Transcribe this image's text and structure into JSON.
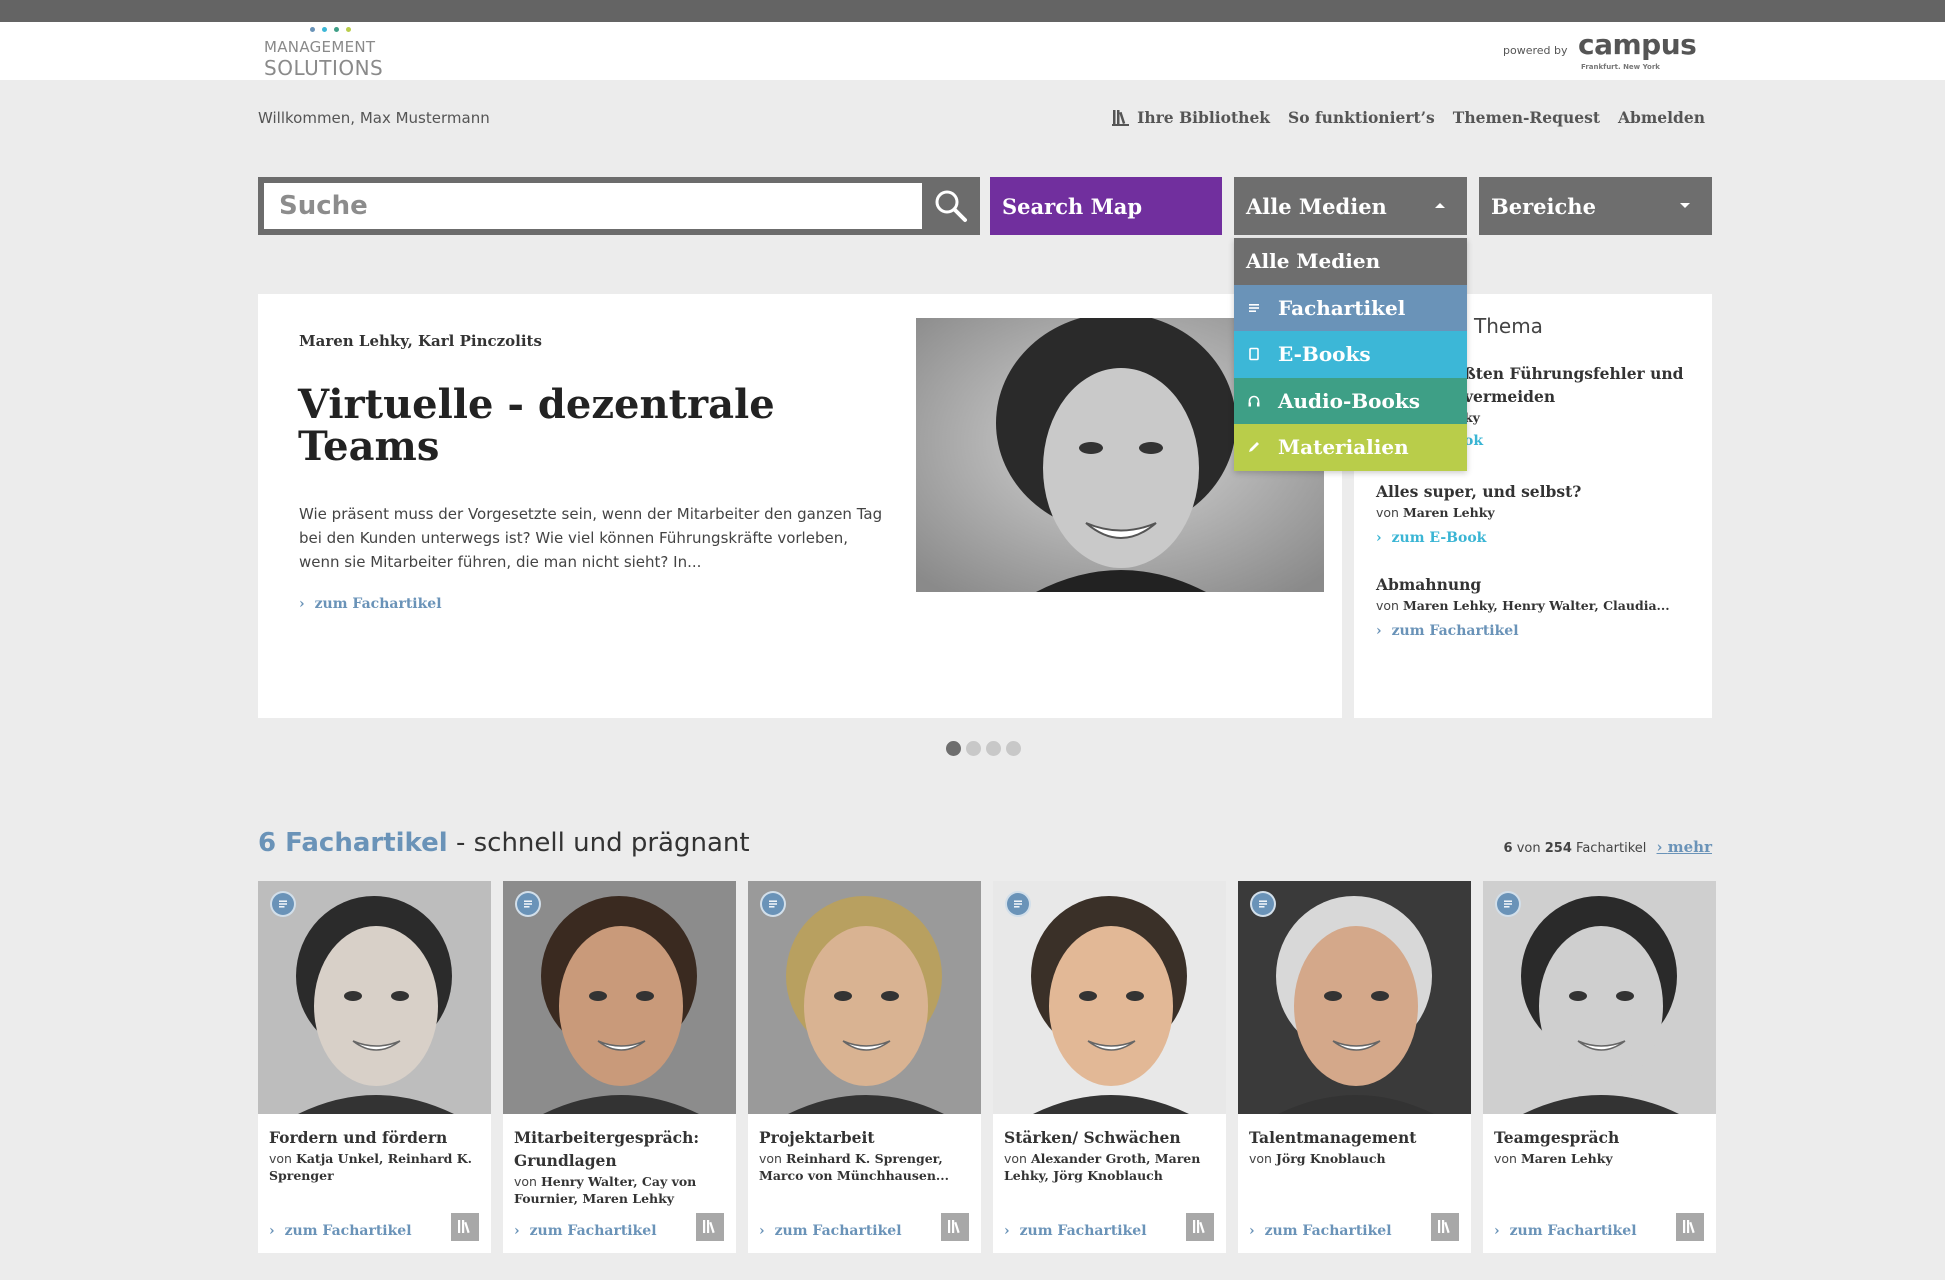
{
  "header": {
    "logo_line1": "MANAGEMENT",
    "logo_line2": "SOLUTIONS",
    "powered_by": "powered by",
    "campus": "campus",
    "campus_sub": "Frankfurt. New York"
  },
  "welcome": "Willkommen, Max Mustermann",
  "topnav": {
    "library": "Ihre Bibliothek",
    "how": "So funktioniert’s",
    "request": "Themen-Request",
    "logout": "Abmelden"
  },
  "search": {
    "placeholder": "Suche"
  },
  "buttons": {
    "search_map": "Search Map",
    "media": "Alle Medien",
    "areas": "Bereiche"
  },
  "dropdown": {
    "items": [
      {
        "label": "Alle Medien",
        "color": "#6e6e6e",
        "icon": ""
      },
      {
        "label": "Fachartikel",
        "color": "#6a93b8",
        "icon": "article-icon"
      },
      {
        "label": "E-Books",
        "color": "#3cb7d7",
        "icon": "ebook-icon"
      },
      {
        "label": "Audio-Books",
        "color": "#3e9f86",
        "icon": "headphones-icon"
      },
      {
        "label": "Materialien",
        "color": "#b9cd4a",
        "icon": "pencil-icon"
      }
    ]
  },
  "hero": {
    "authors": "Maren Lehky, Karl Pinczolits",
    "title": "Virtuelle - dezentrale Teams",
    "description": "Wie präsent muss der Vorgesetzte sein, wenn der Mitarbeiter den ganzen Tag bei den Kunden unterwegs ist? Wie viel können Führungskräfte vorleben, wenn sie Mitarbeiter führen, die man nicht sieht? In...",
    "link": "zum Fachartikel"
  },
  "side": {
    "title_visible": "Thema",
    "items": [
      {
        "title": "ßten Führungsfehler und",
        "title2": "vermeiden",
        "author": "ky",
        "link": "ok"
      },
      {
        "title": "Alles super, und selbst?",
        "by": "von",
        "author": "Maren Lehky",
        "link": "zum E-Book"
      },
      {
        "title": "Abmahnung",
        "by": "von",
        "author": "Maren Lehky, Henry Walter, Claudia...",
        "link": "zum Fachartikel"
      }
    ]
  },
  "pager": {
    "pages": 4,
    "active": 1
  },
  "section": {
    "count_label": "6 Fachartikel",
    "title_rest": " - schnell und prägnant",
    "count_num": "6",
    "count_von": "von",
    "count_total": "254",
    "count_type": "Fachartikel",
    "more": "mehr"
  },
  "cards": [
    {
      "title": "Fordern und fördern",
      "von": "von",
      "authors": "Katja Unkel, Reinhard K. Sprenger",
      "link": "zum Fachartikel"
    },
    {
      "title": "Mitarbeitergespräch: Grundlagen",
      "von": "von",
      "authors": "Henry Walter, Cay von Fournier, Maren Lehky",
      "link": "zum Fachartikel"
    },
    {
      "title": "Projektarbeit",
      "von": "von",
      "authors": "Reinhard K. Sprenger, Marco von Münchhausen...",
      "link": "zum Fachartikel"
    },
    {
      "title": "Stärken/ Schwächen",
      "von": "von",
      "authors": "Alexander Groth, Maren Lehky, Jörg Knoblauch",
      "link": "zum Fachartikel"
    },
    {
      "title": "Talentmanagement",
      "von": "von",
      "authors": "Jörg Knoblauch",
      "link": "zum Fachartikel"
    },
    {
      "title": "Teamgespräch",
      "von": "von",
      "authors": "Maren Lehky",
      "link": "zum Fachartikel"
    }
  ]
}
